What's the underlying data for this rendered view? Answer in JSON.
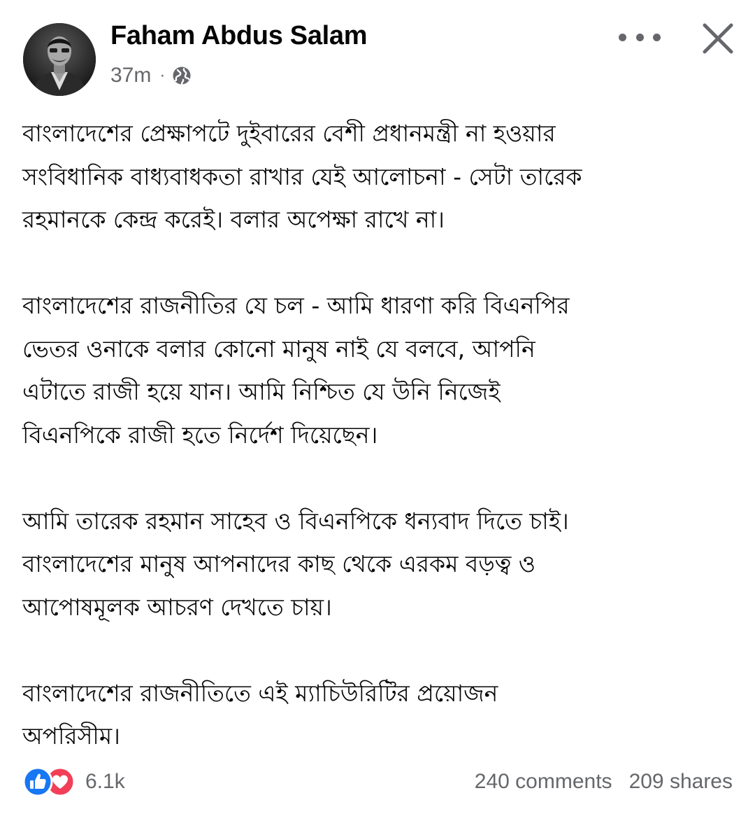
{
  "post": {
    "author": "Faham Abdus Salam",
    "timestamp": "37m",
    "separator": "·",
    "privacy_icon": "globe-icon",
    "menu_icon": "more-horizontal-icon",
    "close_icon": "close-icon",
    "avatar_icon": "profile-photo",
    "paragraphs": [
      {
        "lines": [
          "বাংলাদেশের প্রেক্ষাপটে দুইবারের বেশী প্রধানমন্ত্রী না হওয়ার",
          "সংবিধানিক বাধ্যবাধকতা রাখার যেই আলোচনা - সেটা তারেক",
          "রহমানকে কেন্দ্র করেই। বলার অপেক্ষা রাখে না।"
        ]
      },
      {
        "lines": [
          "বাংলাদেশের রাজনীতির যে চল - আমি ধারণা করি বিএনপির",
          "ভেতর ওনাকে বলার কোনো মানুষ নাই যে বলবে, আপনি",
          "এটাতে রাজী হয়ে যান। আমি নিশ্চিত যে উনি নিজেই",
          "বিএনপিকে রাজী হতে নির্দেশ দিয়েছেন।"
        ]
      },
      {
        "lines": [
          "আমি তারেক রহমান সাহেব ও বিএনপিকে ধন্যবাদ দিতে চাই।",
          "বাংলাদেশের মানুষ আপনাদের কাছ থেকে এরকম বড়ত্ব ও",
          "আপোষমূলক আচরণ দেখতে চায়।"
        ]
      },
      {
        "lines": [
          "বাংলাদেশের রাজনীতিতে এই ম্যাচিউরিটির প্রয়োজন",
          "অপরিসীম।"
        ]
      }
    ]
  },
  "footer": {
    "reaction_count": "6.1k",
    "reaction_icons": [
      "like-icon",
      "love-icon"
    ],
    "comments": "240 comments",
    "shares": "209 shares"
  },
  "colors": {
    "text_primary": "#050505",
    "text_secondary": "#65676b",
    "like_blue": "#1877f2",
    "love_red": "#f33e58"
  }
}
